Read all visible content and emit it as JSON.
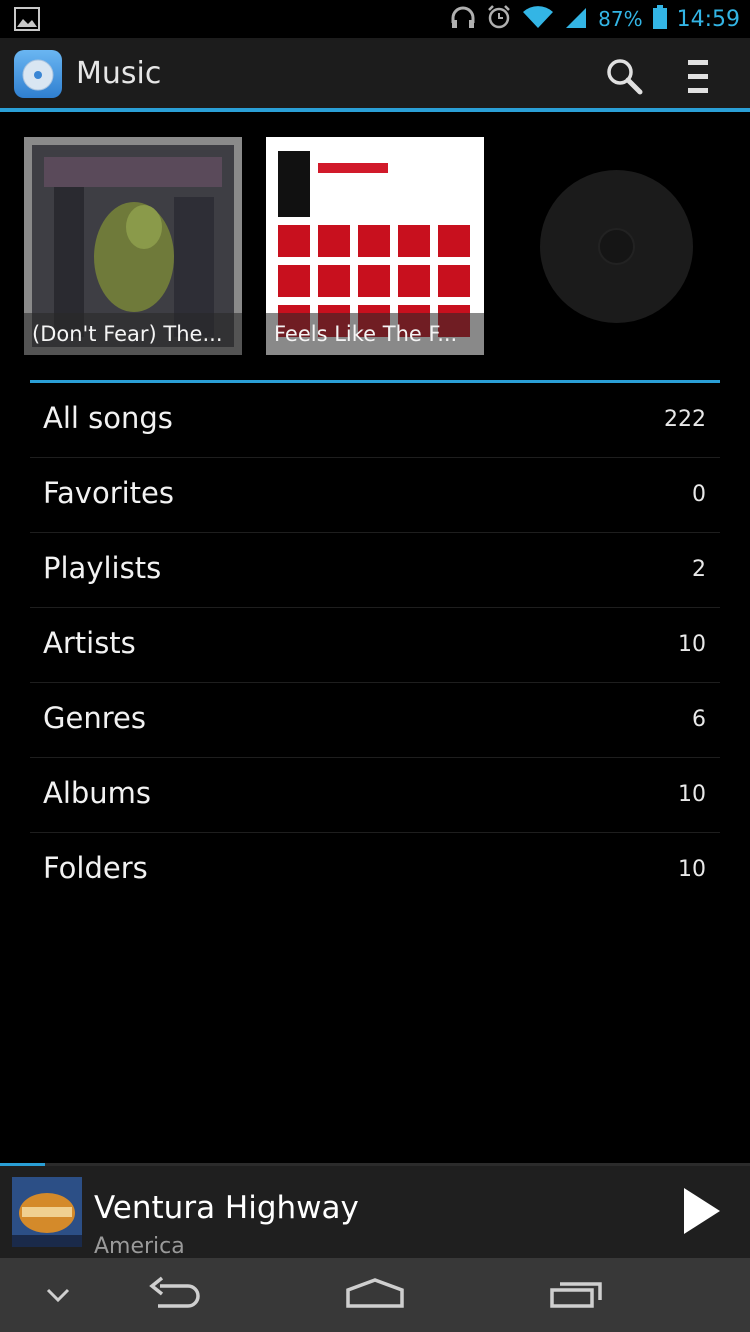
{
  "status_bar": {
    "battery_percent": "87%",
    "time": "14:59",
    "icons": [
      "gallery-notification-icon",
      "headphones-icon",
      "alarm-icon",
      "wifi-icon",
      "signal-icon",
      "battery-icon"
    ]
  },
  "action_bar": {
    "title": "Music",
    "icons": [
      "music-app-icon",
      "search-icon",
      "overflow-menu-icon"
    ]
  },
  "recent_albums": [
    {
      "caption": "(Don't Fear) The..."
    },
    {
      "caption": "Feels Like The F..."
    }
  ],
  "categories": [
    {
      "label": "All songs",
      "count": "222"
    },
    {
      "label": "Favorites",
      "count": "0"
    },
    {
      "label": "Playlists",
      "count": "2"
    },
    {
      "label": "Artists",
      "count": "10"
    },
    {
      "label": "Genres",
      "count": "6"
    },
    {
      "label": "Albums",
      "count": "10"
    },
    {
      "label": "Folders",
      "count": "10"
    }
  ],
  "now_playing": {
    "title": "Ventura Highway",
    "artist": "America",
    "progress_fraction": 0.06
  },
  "nav_bar": {
    "icons": [
      "hide-keyboard-chevron-icon",
      "back-icon",
      "home-icon",
      "recents-icon"
    ]
  },
  "colors": {
    "accent": "#2a9fd6",
    "background": "#000000",
    "action_bar": "#1c1c1c",
    "nav_bar": "#383838"
  }
}
